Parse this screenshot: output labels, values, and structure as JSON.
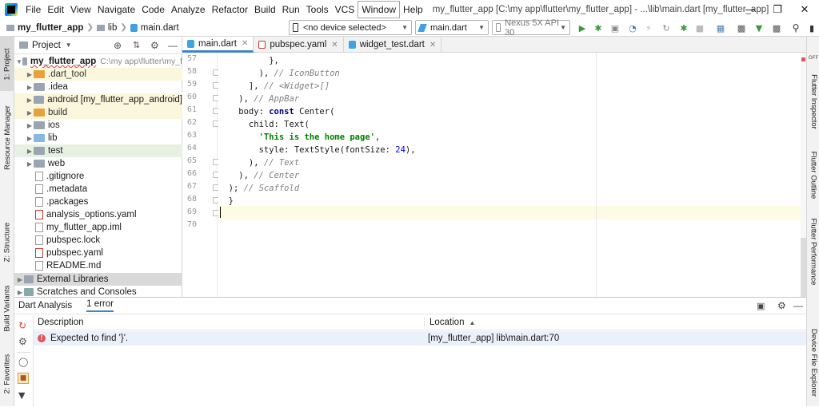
{
  "menu": [
    "File",
    "Edit",
    "View",
    "Navigate",
    "Code",
    "Analyze",
    "Refactor",
    "Build",
    "Run",
    "Tools",
    "VCS",
    "Window",
    "Help"
  ],
  "window_title": "my_flutter_app [C:\\my app\\flutter\\my_flutter_app] - ...\\lib\\main.dart [my_flutter_app]",
  "breadcrumbs": {
    "project": "my_flutter_app",
    "folder": "lib",
    "file": "main.dart"
  },
  "toolbar": {
    "device": "<no device selected>",
    "run_config": "main.dart",
    "emulator": "Nexus 5X API 30"
  },
  "project_panel": {
    "title": "Project",
    "root": {
      "name": "my_flutter_app",
      "path": "C:\\my app\\flutter\\my_f"
    },
    "items": [
      {
        "label": ".dart_tool",
        "kind": "folder-orange",
        "expandable": true
      },
      {
        "label": ".idea",
        "kind": "folder",
        "expandable": true
      },
      {
        "label": "android [my_flutter_app_android]",
        "kind": "folder",
        "expandable": true
      },
      {
        "label": "build",
        "kind": "folder-orange",
        "expandable": true
      },
      {
        "label": "ios",
        "kind": "folder",
        "expandable": true
      },
      {
        "label": "lib",
        "kind": "folder-blue",
        "expandable": true
      },
      {
        "label": "test",
        "kind": "folder-green",
        "expandable": true
      },
      {
        "label": "web",
        "kind": "folder",
        "expandable": true
      },
      {
        "label": ".gitignore",
        "kind": "file",
        "expandable": false
      },
      {
        "label": ".metadata",
        "kind": "file",
        "expandable": false
      },
      {
        "label": ".packages",
        "kind": "file",
        "expandable": false
      },
      {
        "label": "analysis_options.yaml",
        "kind": "yaml",
        "expandable": false
      },
      {
        "label": "my_flutter_app.iml",
        "kind": "file",
        "expandable": false
      },
      {
        "label": "pubspec.lock",
        "kind": "file",
        "expandable": false
      },
      {
        "label": "pubspec.yaml",
        "kind": "yaml",
        "expandable": false
      },
      {
        "label": "README.md",
        "kind": "file",
        "expandable": false
      }
    ],
    "external_libraries": "External Libraries",
    "scratches": "Scratches and Consoles"
  },
  "editor_tabs": [
    {
      "label": "main.dart",
      "active": true
    },
    {
      "label": "pubspec.yaml",
      "active": false
    },
    {
      "label": "widget_test.dart",
      "active": false
    }
  ],
  "code_lines": [
    {
      "num": "57",
      "segments": [
        {
          "t": "          },",
          "c": ""
        }
      ]
    },
    {
      "num": "58",
      "segments": [
        {
          "t": "        ), ",
          "c": ""
        },
        {
          "t": "// IconButton",
          "c": "cm"
        }
      ]
    },
    {
      "num": "59",
      "segments": [
        {
          "t": "      ], ",
          "c": ""
        },
        {
          "t": "// <Widget>[]",
          "c": "cm"
        }
      ]
    },
    {
      "num": "60",
      "segments": [
        {
          "t": "    ), ",
          "c": ""
        },
        {
          "t": "// AppBar",
          "c": "cm"
        }
      ]
    },
    {
      "num": "61",
      "segments": [
        {
          "t": "    body: ",
          "c": ""
        },
        {
          "t": "const",
          "c": "kw"
        },
        {
          "t": " Center(",
          "c": ""
        }
      ]
    },
    {
      "num": "62",
      "segments": [
        {
          "t": "      child: Text(",
          "c": ""
        }
      ]
    },
    {
      "num": "63",
      "segments": [
        {
          "t": "        ",
          "c": ""
        },
        {
          "t": "'This is the home page'",
          "c": "str"
        },
        {
          "t": ",",
          "c": ""
        }
      ]
    },
    {
      "num": "64",
      "segments": [
        {
          "t": "        style: TextStyle(fontSize: ",
          "c": ""
        },
        {
          "t": "24",
          "c": "num"
        },
        {
          "t": "),",
          "c": ""
        }
      ]
    },
    {
      "num": "65",
      "segments": [
        {
          "t": "      ), ",
          "c": ""
        },
        {
          "t": "// Text",
          "c": "cm"
        }
      ]
    },
    {
      "num": "66",
      "segments": [
        {
          "t": "    ), ",
          "c": ""
        },
        {
          "t": "// Center",
          "c": "cm"
        }
      ]
    },
    {
      "num": "67",
      "segments": [
        {
          "t": "  ); ",
          "c": ""
        },
        {
          "t": "// Scaffold",
          "c": "cm"
        }
      ]
    },
    {
      "num": "68",
      "segments": [
        {
          "t": "  }",
          "c": ""
        }
      ]
    },
    {
      "num": "69",
      "segments": [
        {
          "t": "",
          "c": ""
        }
      ]
    },
    {
      "num": "70",
      "segments": [
        {
          "t": "",
          "c": ""
        }
      ]
    }
  ],
  "dart_analysis": {
    "tab_label": "Dart Analysis",
    "error_count": "1 error",
    "columns": {
      "description": "Description",
      "location": "Location"
    },
    "rows": [
      {
        "description": "Expected to find '}'.",
        "location": "[my_flutter_app] lib\\main.dart:70"
      }
    ]
  },
  "left_stripe": [
    "1: Project",
    "Resource Manager",
    "Z: Structure",
    "Build Variants",
    "2: Favorites"
  ],
  "right_stripe": [
    "Flutter Inspector",
    "Flutter Outline",
    "Flutter Performance",
    "Device File Explorer"
  ],
  "right_badge": "OFF",
  "colors": {
    "accent": "#4083c9",
    "selection": "#eaf1fb",
    "error": "#e05555",
    "highlight_line": "#fffae3"
  }
}
